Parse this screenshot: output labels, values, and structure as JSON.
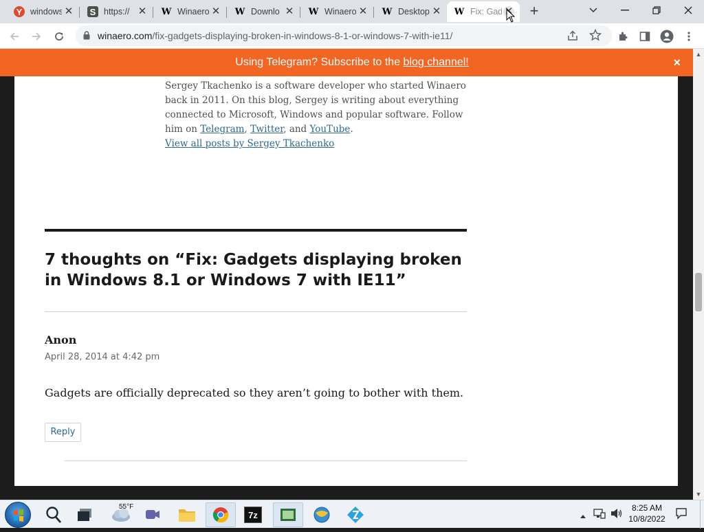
{
  "browser": {
    "tabs": [
      {
        "title": "windows",
        "favicon": "yandex-icon",
        "favicon_glyph": "Y"
      },
      {
        "title": "https://",
        "favicon": "s-icon",
        "favicon_glyph": "S"
      },
      {
        "title": "Winaero",
        "favicon": "winaero-icon",
        "favicon_glyph": "W"
      },
      {
        "title": "Downlo",
        "favicon": "winaero-icon",
        "favicon_glyph": "W"
      },
      {
        "title": "Winaero",
        "favicon": "winaero-icon",
        "favicon_glyph": "W"
      },
      {
        "title": "Desktop",
        "favicon": "winaero-icon",
        "favicon_glyph": "W"
      },
      {
        "title": "Fix: Gad",
        "favicon": "winaero-icon",
        "favicon_glyph": "W",
        "active": true
      }
    ],
    "new_tab_glyph": "+",
    "close_glyph": "✕",
    "url_host": "winaero.com",
    "url_path": "/fix-gadgets-displaying-broken-in-windows-8-1-or-windows-7-with-ie11/"
  },
  "banner": {
    "text_before": "Using Telegram? Subscribe to the ",
    "link_text": "blog channel!",
    "close_glyph": "×",
    "color": "#f26522"
  },
  "page": {
    "bio": {
      "text_1": "Sergey Tkachenko is a software developer who started Winaero back in 2011. On this blog, Sergey is writing about everything connected to Microsoft, Windows and popular software. Follow him on ",
      "link_telegram": "Telegram",
      "sep_1": ", ",
      "link_twitter": "Twitter",
      "sep_2": ", and ",
      "link_youtube": "YouTube",
      "end": ".",
      "view_all": "View all posts by Sergey Tkachenko"
    },
    "comments_title": "7 thoughts on “Fix: Gadgets displaying broken in Windows 8.1 or Windows 7 with IE11”",
    "comment": {
      "author": "Anon",
      "date": "April 28, 2014 at 4:42 pm",
      "body": "Gadgets are officially deprecated so they aren’t going to bother with them.",
      "reply_label": "Reply"
    },
    "link_color": "#2e6990"
  },
  "taskbar": {
    "weather_temp": "55°F",
    "clock_time": "8:25 AM",
    "clock_date": "10/8/2022",
    "sevenzip_label": "7z"
  }
}
